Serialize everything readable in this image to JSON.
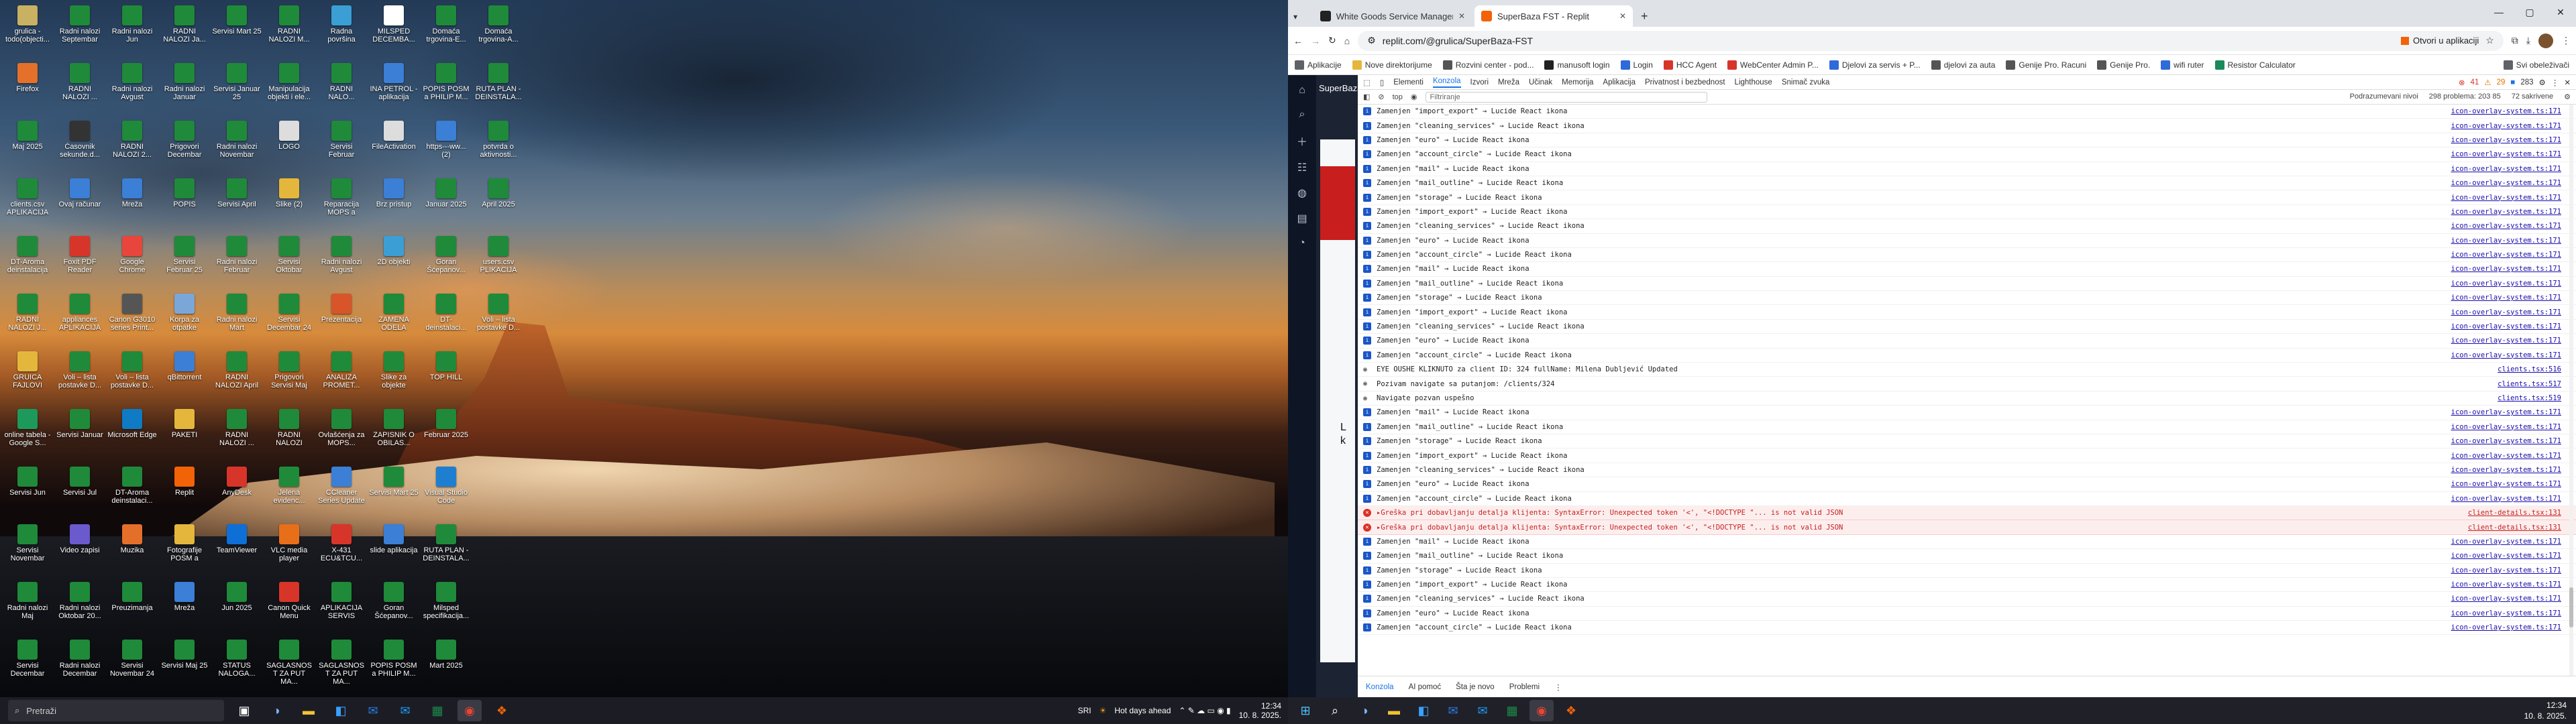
{
  "desktop": {
    "icons": [
      {
        "label": "grulica - todo(objecti...",
        "color": "#c9b164"
      },
      {
        "label": "Firefox",
        "color": "#e5702a"
      },
      {
        "label": "Maj 2025",
        "color": "#1f8a3a"
      },
      {
        "label": "clients.csv APLIKACIJA",
        "color": "#1f8a3a"
      },
      {
        "label": "DT-Aroma deinstalacija",
        "color": "#1f8a3a"
      },
      {
        "label": "RADNI NALOZI J...",
        "color": "#1f8a3a"
      },
      {
        "label": "GRUICA FAJLOVI",
        "color": "#e4b73c"
      },
      {
        "label": "online tabela - Google S...",
        "color": "#1d9a5b"
      },
      {
        "label": "Servisi Jun",
        "color": "#1f8a3a"
      },
      {
        "label": "Servisi Novembar",
        "color": "#1f8a3a"
      },
      {
        "label": "Radni nalozi Maj",
        "color": "#1f8a3a"
      },
      {
        "label": "Servisi Decembar",
        "color": "#1f8a3a"
      },
      {
        "label": "Radni nalozi Septembar",
        "color": "#1f8a3a"
      },
      {
        "label": "RADNI NALOZI ...",
        "color": "#1f8a3a"
      },
      {
        "label": "Časovnik sekunde.d...",
        "color": "#333333"
      },
      {
        "label": "Ovaj računar",
        "color": "#3b7fd6"
      },
      {
        "label": "Foxit PDF Reader",
        "color": "#d8352a"
      },
      {
        "label": "appliances APLIKACIJA",
        "color": "#1f8a3a"
      },
      {
        "label": "Voli – lista postavke D...",
        "color": "#1f8a3a"
      },
      {
        "label": "Servisi Januar",
        "color": "#1f8a3a"
      },
      {
        "label": "Servisi Jul",
        "color": "#1f8a3a"
      },
      {
        "label": "Video zapisi",
        "color": "#6a5acd"
      },
      {
        "label": "Radni nalozi Oktobar 20...",
        "color": "#1f8a3a"
      },
      {
        "label": "Radni nalozi Decembar",
        "color": "#1f8a3a"
      },
      {
        "label": "Radni nalozi Jun",
        "color": "#1f8a3a"
      },
      {
        "label": "Radni nalozi Avgust",
        "color": "#1f8a3a"
      },
      {
        "label": "RADNI NALOZI 2...",
        "color": "#1f8a3a"
      },
      {
        "label": "Mreža",
        "color": "#3b7fd6"
      },
      {
        "label": "Google Chrome",
        "color": "#e8453c"
      },
      {
        "label": "Canon G3010 series Print...",
        "color": "#555555"
      },
      {
        "label": "Voli – lista postavke D...",
        "color": "#1f8a3a"
      },
      {
        "label": "Microsoft Edge",
        "color": "#0f7bc4"
      },
      {
        "label": "DT-Aroma deinstalaci...",
        "color": "#1f8a3a"
      },
      {
        "label": "Muzika",
        "color": "#e46f2a"
      },
      {
        "label": "Preuzimanja",
        "color": "#1f8a3a"
      },
      {
        "label": "Servisi Novembar 24",
        "color": "#1f8a3a"
      },
      {
        "label": "RADNI NALOZI Ja...",
        "color": "#1f8a3a"
      },
      {
        "label": "Radni nalozi Januar",
        "color": "#1f8a3a"
      },
      {
        "label": "Prigovori Decembar",
        "color": "#1f8a3a"
      },
      {
        "label": "POPIS",
        "color": "#1f8a3a"
      },
      {
        "label": "Servisi Februar 25",
        "color": "#1f8a3a"
      },
      {
        "label": "Korpa za otpatke",
        "color": "#7aa7d8"
      },
      {
        "label": "qBittorrent",
        "color": "#3b7fd6"
      },
      {
        "label": "PAKETI",
        "color": "#e4b73c"
      },
      {
        "label": "Replit",
        "color": "#f26207"
      },
      {
        "label": "Fotografije POSM a",
        "color": "#e4b73c"
      },
      {
        "label": "Mreža",
        "color": "#3b7fd6"
      },
      {
        "label": "Servisi Maj 25",
        "color": "#1f8a3a"
      },
      {
        "label": "Servisi Mart 25",
        "color": "#1f8a3a"
      },
      {
        "label": "Servisi Januar 25",
        "color": "#1f8a3a"
      },
      {
        "label": "Radni nalozi Novembar",
        "color": "#1f8a3a"
      },
      {
        "label": "Servisi April",
        "color": "#1f8a3a"
      },
      {
        "label": "Radni nalozi Februar",
        "color": "#1f8a3a"
      },
      {
        "label": "Radni nalozi Mart",
        "color": "#1f8a3a"
      },
      {
        "label": "RADNI NALOZI April",
        "color": "#1f8a3a"
      },
      {
        "label": "RADNI NALOZI ...",
        "color": "#1f8a3a"
      },
      {
        "label": "AnyDesk",
        "color": "#d8352a"
      },
      {
        "label": "TeamViewer",
        "color": "#0e6fd6"
      },
      {
        "label": "Jun 2025",
        "color": "#1f8a3a"
      },
      {
        "label": "STATUS NALOGA...",
        "color": "#1f8a3a"
      },
      {
        "label": "RADNI NALOZI M...",
        "color": "#1f8a3a"
      },
      {
        "label": "Manipulacija objekti i ele...",
        "color": "#1f8a3a"
      },
      {
        "label": "LOGO",
        "color": "#dddddd"
      },
      {
        "label": "Slike (2)",
        "color": "#e4b73c"
      },
      {
        "label": "Servisi Oktobar",
        "color": "#1f8a3a"
      },
      {
        "label": "Servisi Decembar 24",
        "color": "#1f8a3a"
      },
      {
        "label": "Prigovori Servisi Maj",
        "color": "#1f8a3a"
      },
      {
        "label": "RADNI NALOZI",
        "color": "#1f8a3a"
      },
      {
        "label": "Jelena evidenc...",
        "color": "#1f8a3a"
      },
      {
        "label": "VLC media player",
        "color": "#e86f1a"
      },
      {
        "label": "Canon Quick Menu",
        "color": "#d8352a"
      },
      {
        "label": "SAGLASNOST ZA PUT MA...",
        "color": "#1f8a3a"
      },
      {
        "label": "Radna površina",
        "color": "#3b9fd6"
      },
      {
        "label": "RADNI NALO...",
        "color": "#1f8a3a"
      },
      {
        "label": "Servisi Februar",
        "color": "#1f8a3a"
      },
      {
        "label": "Reparacija MOPS a",
        "color": "#1f8a3a"
      },
      {
        "label": "Radni nalozi Avgust",
        "color": "#1f8a3a"
      },
      {
        "label": "Prezentacija",
        "color": "#d8552a"
      },
      {
        "label": "ANALIZA PROMET...",
        "color": "#1f8a3a"
      },
      {
        "label": "Ovlašćenja za MOPS...",
        "color": "#1f8a3a"
      },
      {
        "label": "CCleaner Series Update",
        "color": "#3b7fd6"
      },
      {
        "label": "X-431 ECU&TCU...",
        "color": "#d8352a"
      },
      {
        "label": "APLIKACIJA SERVIS",
        "color": "#1f8a3a"
      },
      {
        "label": "SAGLASNOST ZA PUT MA...",
        "color": "#1f8a3a"
      },
      {
        "label": "MILSPED DECEMBA...",
        "color": "#ffffff"
      },
      {
        "label": "INA PETROL - aplikacija",
        "color": "#3b7fd6"
      },
      {
        "label": "FileActivation",
        "color": "#dddddd"
      },
      {
        "label": "Brz pristup",
        "color": "#3b7fd6"
      },
      {
        "label": "2D objekti",
        "color": "#3b9fd6"
      },
      {
        "label": "ZAMENA ODELA",
        "color": "#1f8a3a"
      },
      {
        "label": "Slike za objekte",
        "color": "#1f8a3a"
      },
      {
        "label": "ZAPISNIK O OBILAS...",
        "color": "#1f8a3a"
      },
      {
        "label": "Servisi Mart 25",
        "color": "#1f8a3a"
      },
      {
        "label": "slide aplikacija",
        "color": "#3b7fd6"
      },
      {
        "label": "Goran Šćepanov...",
        "color": "#1f8a3a"
      },
      {
        "label": "POPIS POSM a PHILIP M...",
        "color": "#1f8a3a"
      },
      {
        "label": "Domaća trgovina-E...",
        "color": "#1f8a3a"
      },
      {
        "label": "POPIS POSM a PHILIP M...",
        "color": "#1f8a3a"
      },
      {
        "label": "https---ww... (2)",
        "color": "#3b7fd6"
      },
      {
        "label": "Januar 2025",
        "color": "#1f8a3a"
      },
      {
        "label": "Goran Šćepanov...",
        "color": "#1f8a3a"
      },
      {
        "label": "DT-deinstalaci...",
        "color": "#1f8a3a"
      },
      {
        "label": "TOP HILL",
        "color": "#1f8a3a"
      },
      {
        "label": "Februar 2025",
        "color": "#1f8a3a"
      },
      {
        "label": "Visual Studio Code",
        "color": "#1e7fd1"
      },
      {
        "label": "RUTA PLAN - DEINSTALA...",
        "color": "#1f8a3a"
      },
      {
        "label": "Milsped specifikacija...",
        "color": "#1f8a3a"
      },
      {
        "label": "Mart 2025",
        "color": "#1f8a3a"
      },
      {
        "label": "Domaća trgovina-A...",
        "color": "#1f8a3a"
      },
      {
        "label": "RUTA PLAN - DEINSTALA...",
        "color": "#1f8a3a"
      },
      {
        "label": "potvrda o aktivnosti...",
        "color": "#1f8a3a"
      },
      {
        "label": "April 2025",
        "color": "#1f8a3a"
      },
      {
        "label": "users.csv PLIKACIJA",
        "color": "#1f8a3a"
      },
      {
        "label": "Voli – lista postavke D...",
        "color": "#1f8a3a"
      }
    ]
  },
  "taskbar_left": {
    "search_placeholder": "Pretraži",
    "weather": "Hot days ahead",
    "lang": "SRI",
    "time": "12:34",
    "date": "10. 8. 2025."
  },
  "chrome": {
    "tabs": [
      {
        "title": "White Goods Service Manager",
        "favicon_color": "#222222"
      },
      {
        "title": "SuperBaza FST - Replit",
        "favicon_color": "#f26207"
      }
    ],
    "new_tab": "+",
    "url": "replit.com/@grulica/SuperBaza-FST",
    "open_in_app": "Otvori u aplikaciji",
    "bookmarks": [
      {
        "label": "Aplikacije",
        "color": "#5f6368"
      },
      {
        "label": "Nove direktorijume",
        "color": "#e4b73c"
      },
      {
        "label": "Rozvini center - pod...",
        "color": "#555555"
      },
      {
        "label": "manusoft login",
        "color": "#222222"
      },
      {
        "label": "Login",
        "color": "#2f6ad9"
      },
      {
        "label": "HCC Agent",
        "color": "#d8352a"
      },
      {
        "label": "WebCenter Admin P...",
        "color": "#d8352a"
      },
      {
        "label": "Djelovi za servis + P...",
        "color": "#2f6ad9"
      },
      {
        "label": "djelovi za auta",
        "color": "#555555"
      },
      {
        "label": "Genije Pro. Racuni",
        "color": "#555555"
      },
      {
        "label": "Genije Pro.",
        "color": "#555555"
      },
      {
        "label": "wifi ruter",
        "color": "#2f6ad9"
      },
      {
        "label": "Resistor Calculator",
        "color": "#1a8a5a"
      }
    ],
    "all_bookmarks": "Svi obeleživači"
  },
  "replit": {
    "project_title": "SuperBaza FST",
    "preview_heading": "L\nk"
  },
  "devtools": {
    "tabs": [
      "Elementi",
      "Konzola",
      "Izvori",
      "Mreža",
      "Učinak",
      "Memorija",
      "Aplikacija",
      "Privatnost i bezbednost",
      "Lighthouse",
      "Snimač zvuka"
    ],
    "active_tab": "Konzola",
    "error_count": "41",
    "warn_count": "29",
    "info_count": "283",
    "context": "top",
    "filter_placeholder": "Filtriranje",
    "levels": "Podrazumevani nivoi",
    "issues": "298 problema: 203 85",
    "hidden": "72 sakrivene",
    "bottom_tabs": [
      "Konzola",
      "AI pomoć",
      "Šta je novo",
      "Problemi"
    ],
    "rows": [
      {
        "type": "log",
        "text": "Zamenjen \"import_export\" → Lucide React ikona",
        "src": "icon-overlay-system.ts:171"
      },
      {
        "type": "log",
        "text": "Zamenjen \"cleaning_services\" → Lucide React ikona",
        "src": "icon-overlay-system.ts:171"
      },
      {
        "type": "log",
        "text": "Zamenjen \"euro\" → Lucide React ikona",
        "src": "icon-overlay-system.ts:171"
      },
      {
        "type": "log",
        "text": "Zamenjen \"account_circle\" → Lucide React ikona",
        "src": "icon-overlay-system.ts:171"
      },
      {
        "type": "log",
        "text": "Zamenjen \"mail\" → Lucide React ikona",
        "src": "icon-overlay-system.ts:171"
      },
      {
        "type": "log",
        "text": "Zamenjen \"mail_outline\" → Lucide React ikona",
        "src": "icon-overlay-system.ts:171"
      },
      {
        "type": "log",
        "text": "Zamenjen \"storage\" → Lucide React ikona",
        "src": "icon-overlay-system.ts:171"
      },
      {
        "type": "log",
        "text": "Zamenjen \"import_export\" → Lucide React ikona",
        "src": "icon-overlay-system.ts:171"
      },
      {
        "type": "log",
        "text": "Zamenjen \"cleaning_services\" → Lucide React ikona",
        "src": "icon-overlay-system.ts:171"
      },
      {
        "type": "log",
        "text": "Zamenjen \"euro\" → Lucide React ikona",
        "src": "icon-overlay-system.ts:171"
      },
      {
        "type": "log",
        "text": "Zamenjen \"account_circle\" → Lucide React ikona",
        "src": "icon-overlay-system.ts:171"
      },
      {
        "type": "log",
        "text": "Zamenjen \"mail\" → Lucide React ikona",
        "src": "icon-overlay-system.ts:171"
      },
      {
        "type": "log",
        "text": "Zamenjen \"mail_outline\" → Lucide React ikona",
        "src": "icon-overlay-system.ts:171"
      },
      {
        "type": "log",
        "text": "Zamenjen \"storage\" → Lucide React ikona",
        "src": "icon-overlay-system.ts:171"
      },
      {
        "type": "log",
        "text": "Zamenjen \"import_export\" → Lucide React ikona",
        "src": "icon-overlay-system.ts:171"
      },
      {
        "type": "log",
        "text": "Zamenjen \"cleaning_services\" → Lucide React ikona",
        "src": "icon-overlay-system.ts:171"
      },
      {
        "type": "log",
        "text": "Zamenjen \"euro\" → Lucide React ikona",
        "src": "icon-overlay-system.ts:171"
      },
      {
        "type": "log",
        "text": "Zamenjen \"account_circle\" → Lucide React ikona",
        "src": "icon-overlay-system.ts:171"
      },
      {
        "type": "info",
        "text": "EYE OUSHE KLIKNUTO za client ID: 324 fullName: Milena Dubljević Updated",
        "src": "clients.tsx:516"
      },
      {
        "type": "info",
        "text": "Pozivam navigate sa putanjom: /clients/324",
        "src": "clients.tsx:517"
      },
      {
        "type": "info",
        "text": "Navigate pozvan uspešno",
        "src": "clients.tsx:519"
      },
      {
        "type": "log",
        "text": "Zamenjen \"mail\" → Lucide React ikona",
        "src": "icon-overlay-system.ts:171"
      },
      {
        "type": "log",
        "text": "Zamenjen \"mail_outline\" → Lucide React ikona",
        "src": "icon-overlay-system.ts:171"
      },
      {
        "type": "log",
        "text": "Zamenjen \"storage\" → Lucide React ikona",
        "src": "icon-overlay-system.ts:171"
      },
      {
        "type": "log",
        "text": "Zamenjen \"import_export\" → Lucide React ikona",
        "src": "icon-overlay-system.ts:171"
      },
      {
        "type": "log",
        "text": "Zamenjen \"cleaning_services\" → Lucide React ikona",
        "src": "icon-overlay-system.ts:171"
      },
      {
        "type": "log",
        "text": "Zamenjen \"euro\" → Lucide React ikona",
        "src": "icon-overlay-system.ts:171"
      },
      {
        "type": "log",
        "text": "Zamenjen \"account_circle\" → Lucide React ikona",
        "src": "icon-overlay-system.ts:171"
      },
      {
        "type": "error",
        "text": "▸Greška pri dobavljanju detalja klijenta: SyntaxError: Unexpected token '<', \"<!DOCTYPE \"... is not valid JSON",
        "src": "client-details.tsx:131"
      },
      {
        "type": "error",
        "text": "▸Greška pri dobavljanju detalja klijenta: SyntaxError: Unexpected token '<', \"<!DOCTYPE \"... is not valid JSON",
        "src": "client-details.tsx:131"
      },
      {
        "type": "log",
        "text": "Zamenjen \"mail\" → Lucide React ikona",
        "src": "icon-overlay-system.ts:171"
      },
      {
        "type": "log",
        "text": "Zamenjen \"mail_outline\" → Lucide React ikona",
        "src": "icon-overlay-system.ts:171"
      },
      {
        "type": "log",
        "text": "Zamenjen \"storage\" → Lucide React ikona",
        "src": "icon-overlay-system.ts:171"
      },
      {
        "type": "log",
        "text": "Zamenjen \"import_export\" → Lucide React ikona",
        "src": "icon-overlay-system.ts:171"
      },
      {
        "type": "log",
        "text": "Zamenjen \"cleaning_services\" → Lucide React ikona",
        "src": "icon-overlay-system.ts:171"
      },
      {
        "type": "log",
        "text": "Zamenjen \"euro\" → Lucide React ikona",
        "src": "icon-overlay-system.ts:171"
      },
      {
        "type": "log",
        "text": "Zamenjen \"account_circle\" → Lucide React ikona",
        "src": "icon-overlay-system.ts:171"
      }
    ]
  },
  "taskbar_right": {
    "time": "12:34",
    "date": "10. 8. 2025."
  }
}
